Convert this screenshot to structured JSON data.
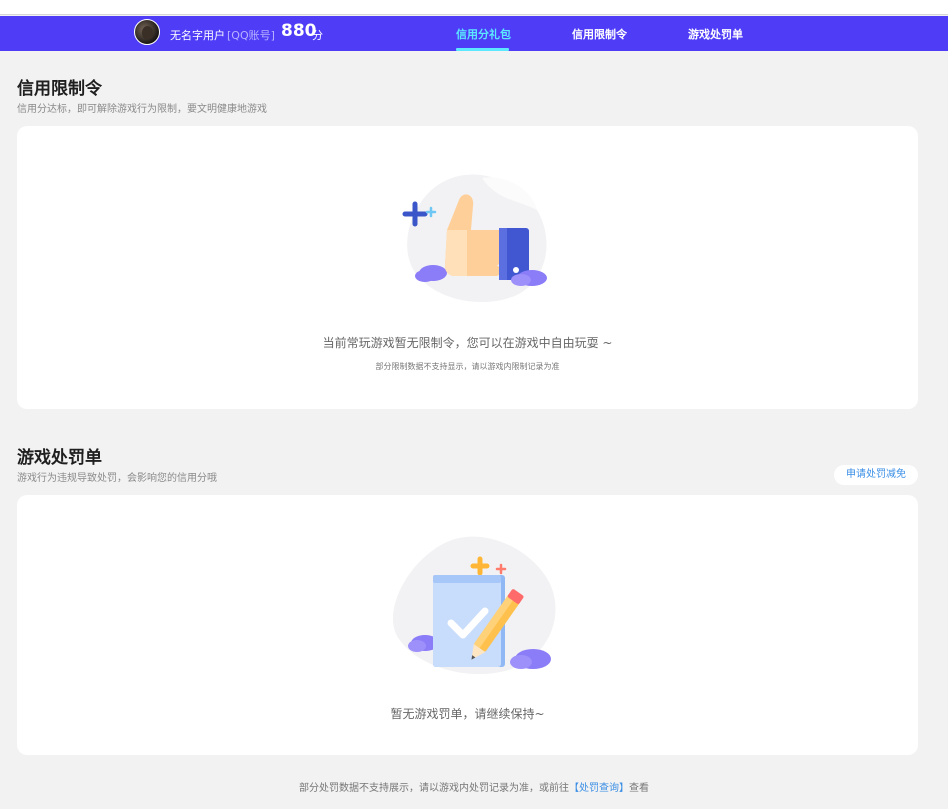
{
  "header": {
    "user_name": "无名字用户",
    "account_type": "[QQ账号]",
    "score": "880",
    "score_unit": "分",
    "tabs": [
      {
        "label": "信用分礼包",
        "active": true
      },
      {
        "label": "信用限制令",
        "active": false
      },
      {
        "label": "游戏处罚单",
        "active": false
      }
    ]
  },
  "restriction": {
    "title": "信用限制令",
    "subtitle": "信用分达标，即可解除游戏行为限制，要文明健康地游戏",
    "empty_message": "当前常玩游戏暂无限制令，您可以在游戏中自由玩耍 ~",
    "note": "部分限制数据不支持显示，请以游戏内限制记录为准",
    "illustration_icon": "thumbs-up-icon"
  },
  "penalty": {
    "title": "游戏处罚单",
    "subtitle": "游戏行为违规导致处罚，会影响您的信用分哦",
    "appeal_label": "申请处罚减免",
    "empty_message": "暂无游戏罚单，请继续保持~",
    "illustration_icon": "checked-document-pencil-icon"
  },
  "footer": {
    "text_before": "部分处罚数据不支持展示，请以游戏内处罚记录为准，或前往",
    "link_label": "【处罚查询】",
    "text_after": "查看"
  },
  "colors": {
    "nav_bg": "#4e3cf7",
    "active_tab": "#5ce8ff",
    "link": "#3a8ee6",
    "page_bg": "#f2f2f2"
  }
}
